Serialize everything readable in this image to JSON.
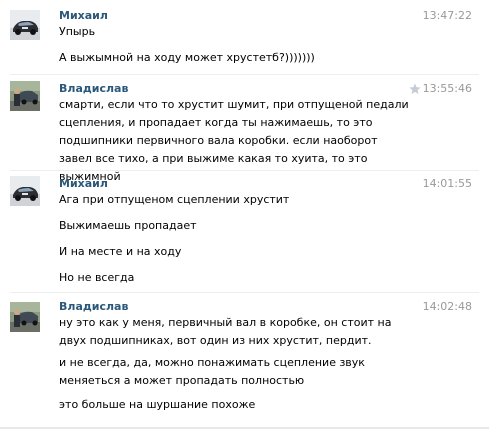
{
  "messages": [
    {
      "author": "Михаил",
      "time": "13:47:22",
      "avatar": "car-photo-avatar",
      "paragraphs": [
        "Упырь",
        "А выжымной на ходу может хрустетб?)))))))"
      ]
    },
    {
      "author": "Владислав",
      "time": "13:55:46",
      "avatar": "person-by-car-avatar",
      "paragraphs": [
        "смарти, если что то хрустит шумит, при отпущеной педали сцепления, и пропадает когда ты нажимаешь, то это подшипники первичного вала коробки. если наоборот завел все тихо, а при выжиме какая то хуита, то это выжимной"
      ]
    },
    {
      "author": "Михаил",
      "time": "14:01:55",
      "avatar": "car-photo-avatar",
      "paragraphs": [
        "Ага при отпущеном сцеплении хрустит",
        "Выжимаешь пропадает",
        "И на месте и на ходу",
        "Но не всегда"
      ]
    },
    {
      "author": "Владислав",
      "time": "14:02:48",
      "avatar": "person-by-car-avatar",
      "paragraphs": [
        "ну это как у меня, первичный вал в коробке, он стоит на двух подшипниках, вот один из них хрустит, пердит.",
        "и не всегда, да, можно понажимать сцепление звук меняеться а может пропадать полностью",
        "это больше на шуршание похоже"
      ]
    }
  ]
}
